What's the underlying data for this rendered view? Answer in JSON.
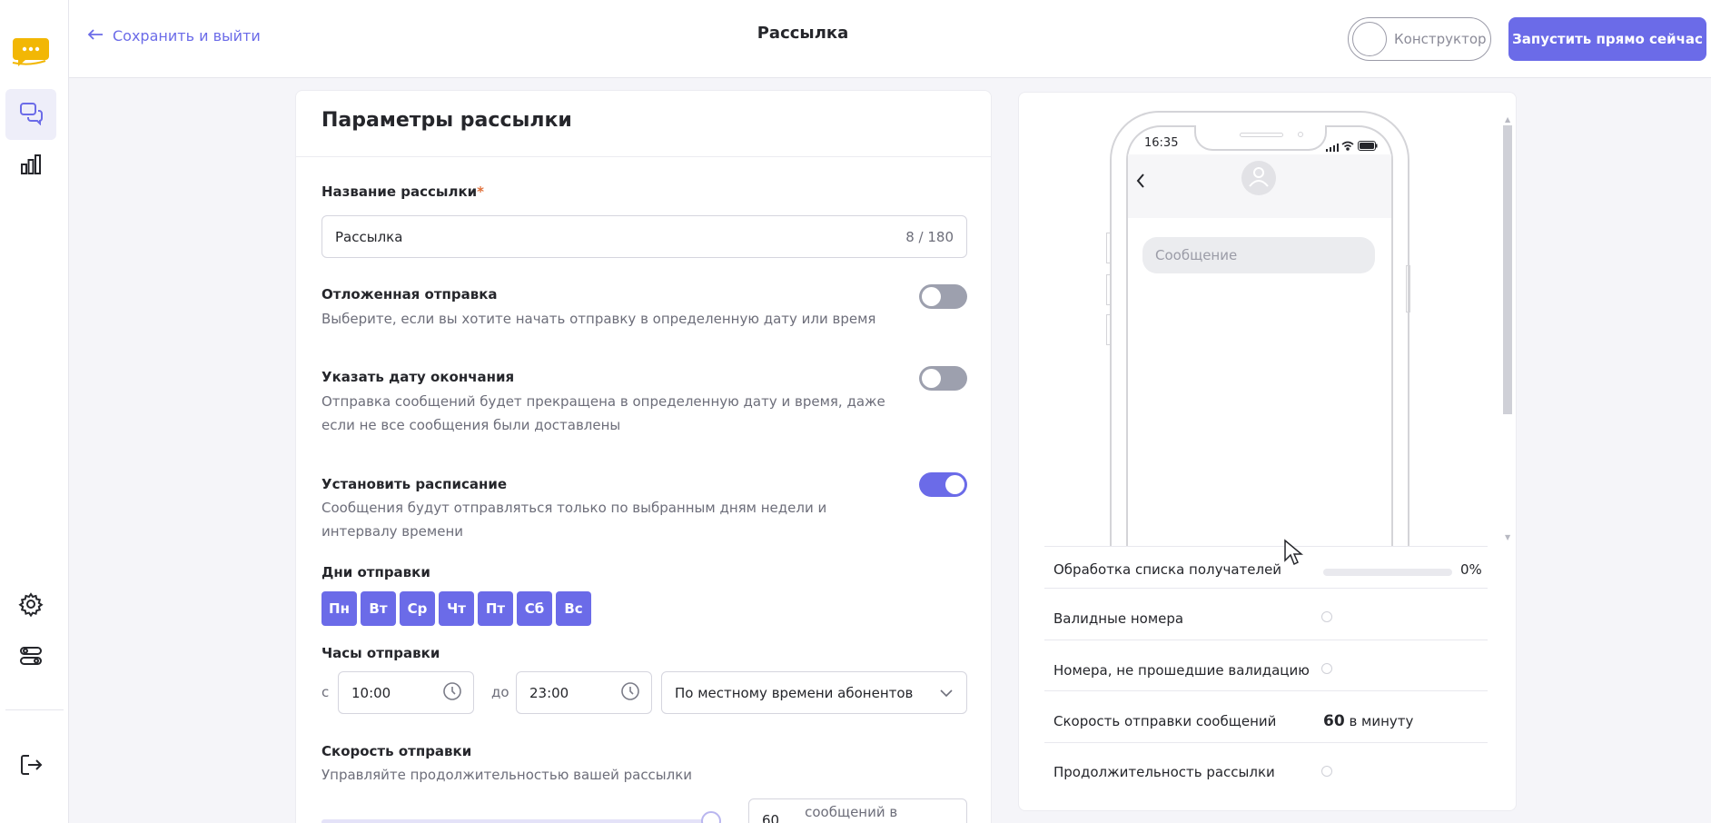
{
  "header": {
    "back_label": "Сохранить и выйти",
    "title": "Рассылка",
    "constructor_label": "Конструктор",
    "launch_label": "Запустить прямо сейчас"
  },
  "sidebar": {
    "items": [
      {
        "icon": "chat-logo-icon",
        "active": false
      },
      {
        "icon": "messages-icon",
        "active": true
      },
      {
        "icon": "bar-chart-icon",
        "active": false
      },
      {
        "icon": "gear-icon",
        "active": false
      },
      {
        "icon": "toggles-icon",
        "active": false
      },
      {
        "icon": "logout-icon",
        "active": false
      }
    ],
    "logo_color": "#f2b705"
  },
  "form": {
    "title": "Параметры рассылки",
    "name_label": "Название рассылки",
    "name_required": "*",
    "name_value": "Рассылка",
    "name_counter": "8 / 180",
    "delayed": {
      "title": "Отложенная отправка",
      "desc": "Выберите, если вы хотите начать отправку в определенную дату или время",
      "enabled": false
    },
    "end_date": {
      "title": "Указать дату окончания",
      "desc": "Отправка сообщений будет прекращена в определенную дату и время, даже если не все сообщения были доставлены",
      "enabled": false
    },
    "schedule": {
      "title": "Установить расписание",
      "desc": "Сообщения будут отправляться только по выбранным дням недели и интервалу времени",
      "enabled": true
    },
    "days_label": "Дни отправки",
    "days": [
      "Пн",
      "Вт",
      "Ср",
      "Чт",
      "Пт",
      "Сб",
      "Вс"
    ],
    "hours_label": "Часы отправки",
    "from_label": "с",
    "from_value": "10:00",
    "to_label": "до",
    "to_value": "23:00",
    "timezone": "По местному времени абонентов",
    "speed_label": "Скорость отправки",
    "speed_desc": "Управляйте продолжительностью вашей рассылки",
    "speed_value": "60",
    "speed_unit": "сообщений в минуту",
    "slider_fraction": 1.0
  },
  "preview": {
    "phone_time": "16:35",
    "bubble_placeholder": "Сообщение",
    "rows": {
      "processing": "Обработка списка получателей",
      "processing_percent": "0%",
      "processing_fraction": 0,
      "valid": "Валидные номера",
      "invalid": "Номера, не прошедшие валидацию",
      "speed": "Скорость отправки сообщений",
      "speed_value": "60",
      "speed_unit": "в минуту",
      "duration": "Продолжительность рассылки"
    }
  },
  "colors": {
    "accent": "#6b6be8",
    "toggle_off": "#9da0ae",
    "required": "#e0703a"
  }
}
